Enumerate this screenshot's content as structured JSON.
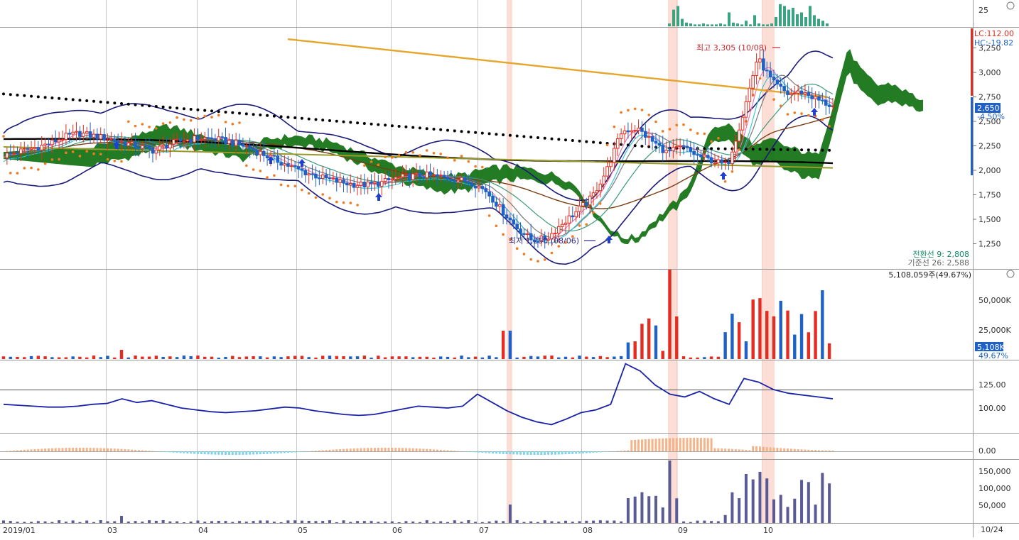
{
  "chart_data": {
    "type": "candlestick-multi-panel",
    "x_axis": {
      "labels": [
        "2019/01",
        "03",
        "04",
        "05",
        "06",
        "07",
        "08",
        "09",
        "10"
      ],
      "right_date": "10/24"
    },
    "price_panel": {
      "ylim": [
        1000,
        3450
      ],
      "y_ticks": [
        "1,250",
        "1,500",
        "1,750",
        "2,000",
        "2,250",
        "2,500",
        "2,750",
        "3,000",
        "3,250"
      ],
      "current_price": "2,650",
      "current_change": "-4.50%",
      "lc_label": "LC:112.00",
      "hc_label": "HC:-19.82",
      "high_annotation": "최고 3,305 (10/08)",
      "low_annotation": "최저 1,250 (08/06)",
      "info_line1": "전환선 9: 2,808",
      "info_line2": "기준선 26: 2,588",
      "info_line3": "5,108,059주(49.67%)",
      "close_series": [
        2150,
        2190,
        2230,
        2270,
        2340,
        2380,
        2350,
        2320,
        2280,
        2240,
        2200,
        2270,
        2310,
        2330,
        2320,
        2290,
        2250,
        2180,
        2110,
        2040,
        1980,
        1930,
        1890,
        1860,
        1850,
        1870,
        1920,
        1940,
        1950,
        1930,
        1910,
        1880,
        1790,
        1600,
        1420,
        1290,
        1300,
        1450,
        1580,
        1720,
        2000,
        2400,
        2430,
        2300,
        2180,
        2240,
        2150,
        2100,
        2050,
        2550,
        3150,
        2900,
        2780,
        2800,
        2720,
        2650
      ]
    },
    "top_histogram": {
      "tick": "25",
      "values": [
        3,
        18,
        22,
        8,
        4,
        3,
        2,
        2,
        3,
        2,
        2,
        2,
        3,
        2,
        15,
        4,
        3,
        2,
        6,
        2,
        12,
        3,
        2,
        2,
        3,
        10,
        24,
        22,
        18,
        20,
        13,
        15,
        10,
        22,
        12,
        8,
        6,
        3
      ]
    },
    "volume_panel": {
      "y_ticks": [
        "25,000K",
        "50,000K"
      ],
      "current": "5,108K",
      "current_pct": "49.67%",
      "series": [
        {
          "name": "up",
          "color": "#e52c20"
        },
        {
          "name": "down",
          "color": "#1f61c6"
        }
      ]
    },
    "oscillator_panel": {
      "y_ticks": [
        "100.00",
        "125.00"
      ],
      "reference": 120,
      "values": [
        104,
        103,
        102,
        101,
        101,
        102,
        104,
        105,
        110,
        106,
        108,
        104,
        100,
        98,
        96,
        95,
        96,
        97,
        99,
        101,
        100,
        97,
        95,
        93,
        92,
        93,
        96,
        99,
        102,
        101,
        100,
        102,
        115,
        106,
        97,
        90,
        85,
        82,
        88,
        95,
        98,
        104,
        148,
        140,
        125,
        115,
        112,
        118,
        110,
        104,
        132,
        128,
        120,
        116,
        114,
        112,
        110
      ]
    },
    "macd_panel": {
      "y_ticks": [
        "0.00"
      ],
      "pos_color": "#f4b48a",
      "neg_color": "#7fd2e8"
    },
    "bottom_volume_panel": {
      "y_ticks": [
        "50,000",
        "100,000",
        "150,000"
      ],
      "color": "#5a5a96"
    },
    "highlight_bands": [
      "07 mid",
      "08 end",
      "10 start"
    ],
    "colors": {
      "up_candle": "#e52c20",
      "down_candle": "#1f61c6",
      "ichimoku_cloud": "#0b6e0b",
      "bollinger": "#1a1a7a",
      "long_ma": "#e4a62c",
      "parabolic_sar": "#f07a20",
      "black_ma": "#000000",
      "highlight": "#fbd3c8"
    }
  }
}
